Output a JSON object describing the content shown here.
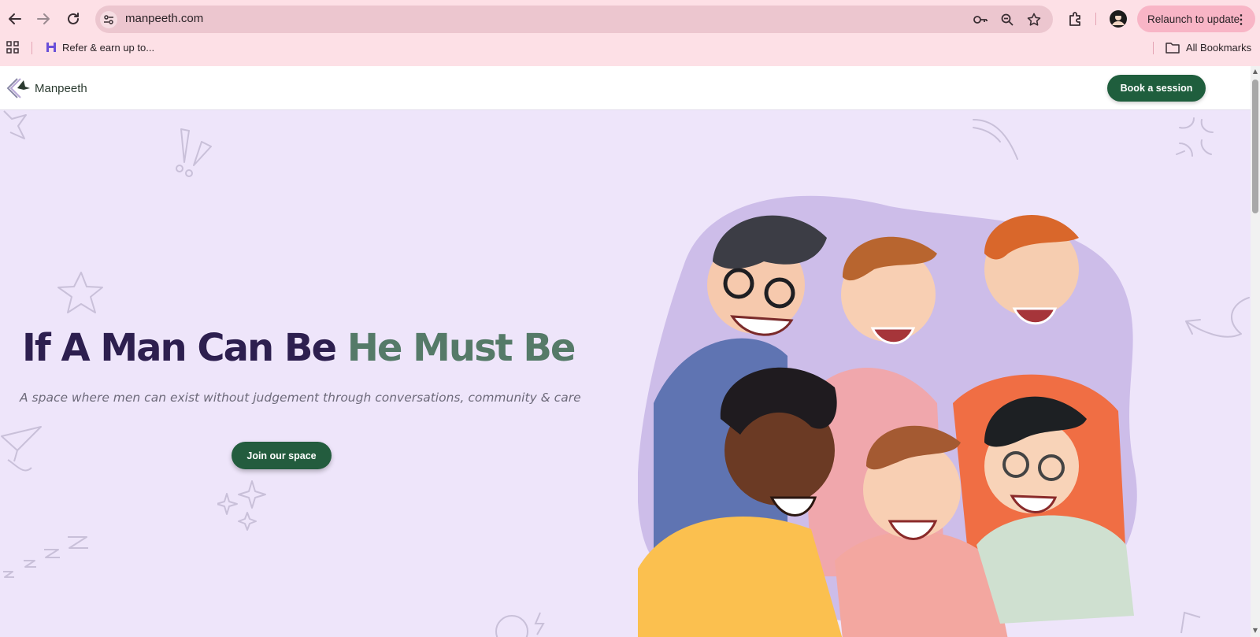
{
  "browser": {
    "url": "manpeeth.com",
    "relaunch_label": "Relaunch to update",
    "bookmarks": {
      "item_label": "Refer & earn up to...",
      "all_bookmarks_label": "All Bookmarks"
    }
  },
  "site": {
    "logo_text": "Manpeeth",
    "book_button": "Book a session",
    "hero": {
      "title_part1": "If A Man Can Be",
      "title_part2": "He Must Be",
      "subtitle": "A space where men can exist without judgement through conversations, community & care",
      "cta": "Join our space"
    }
  },
  "colors": {
    "browser_bar": "#fde0e6",
    "omnibox": "#ecc6cf",
    "page_bg": "#eee5fa",
    "accent_green": "#1f5e3d",
    "title_dark": "#2d1f4f",
    "title_green": "#557a68"
  },
  "icons": [
    "back-icon",
    "forward-icon",
    "reload-icon",
    "site-settings-icon",
    "password-key-icon",
    "zoom-icon",
    "star-icon",
    "extensions-icon",
    "profile-avatar",
    "apps-grid-icon",
    "folder-icon"
  ]
}
